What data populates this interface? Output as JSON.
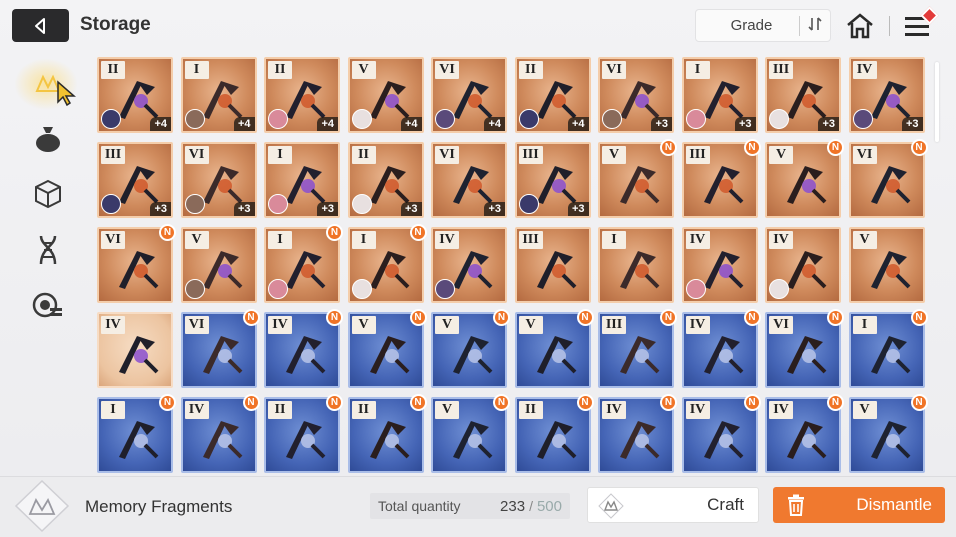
{
  "header": {
    "title": "Storage",
    "sort_label": "Grade",
    "back_icon": "arrow-left-icon",
    "home_icon": "home-icon",
    "menu_icon": "hamburger-menu-icon"
  },
  "sidebar": {
    "items": [
      {
        "icon": "memory-fragment-icon",
        "active": true
      },
      {
        "icon": "bag-icon",
        "active": false
      },
      {
        "icon": "cube-icon",
        "active": false
      },
      {
        "icon": "dna-icon",
        "active": false
      },
      {
        "icon": "chip-list-icon",
        "active": false
      }
    ]
  },
  "colors": {
    "orange_card": "#cf8a5c",
    "blue_card": "#4565b6",
    "peach_card": "#ecc4a0",
    "new_badge": "#f07427",
    "dismantle": "#f0792f"
  },
  "items": [
    {
      "grade": "II",
      "type": "orange",
      "level": "+4",
      "new": false,
      "avatar": true
    },
    {
      "grade": "I",
      "type": "orange",
      "level": "+4",
      "new": false,
      "avatar": true
    },
    {
      "grade": "II",
      "type": "orange",
      "level": "+4",
      "new": false,
      "avatar": true
    },
    {
      "grade": "V",
      "type": "orange",
      "level": "+4",
      "new": false,
      "avatar": true
    },
    {
      "grade": "VI",
      "type": "orange",
      "level": "+4",
      "new": false,
      "avatar": true
    },
    {
      "grade": "II",
      "type": "orange",
      "level": "+4",
      "new": false,
      "avatar": true
    },
    {
      "grade": "VI",
      "type": "orange",
      "level": "+3",
      "new": false,
      "avatar": true
    },
    {
      "grade": "I",
      "type": "orange",
      "level": "+3",
      "new": false,
      "avatar": true
    },
    {
      "grade": "III",
      "type": "orange",
      "level": "+3",
      "new": false,
      "avatar": true
    },
    {
      "grade": "IV",
      "type": "orange",
      "level": "+3",
      "new": false,
      "avatar": true
    },
    {
      "grade": "III",
      "type": "orange",
      "level": "+3",
      "new": false,
      "avatar": true
    },
    {
      "grade": "VI",
      "type": "orange",
      "level": "+3",
      "new": false,
      "avatar": true
    },
    {
      "grade": "I",
      "type": "orange",
      "level": "+3",
      "new": false,
      "avatar": true
    },
    {
      "grade": "II",
      "type": "orange",
      "level": "+3",
      "new": false,
      "avatar": true
    },
    {
      "grade": "VI",
      "type": "orange",
      "level": "+3",
      "new": false,
      "avatar": false
    },
    {
      "grade": "III",
      "type": "orange",
      "level": "+3",
      "new": false,
      "avatar": true
    },
    {
      "grade": "V",
      "type": "orange",
      "level": "",
      "new": true,
      "avatar": false
    },
    {
      "grade": "III",
      "type": "orange",
      "level": "",
      "new": true,
      "avatar": false
    },
    {
      "grade": "V",
      "type": "orange",
      "level": "",
      "new": true,
      "avatar": false
    },
    {
      "grade": "VI",
      "type": "orange",
      "level": "",
      "new": true,
      "avatar": false
    },
    {
      "grade": "VI",
      "type": "orange",
      "level": "",
      "new": true,
      "avatar": false
    },
    {
      "grade": "V",
      "type": "orange",
      "level": "",
      "new": false,
      "avatar": true
    },
    {
      "grade": "I",
      "type": "orange",
      "level": "",
      "new": true,
      "avatar": true
    },
    {
      "grade": "I",
      "type": "orange",
      "level": "",
      "new": true,
      "avatar": true
    },
    {
      "grade": "IV",
      "type": "orange",
      "level": "",
      "new": false,
      "avatar": true
    },
    {
      "grade": "III",
      "type": "orange",
      "level": "",
      "new": false,
      "avatar": false
    },
    {
      "grade": "I",
      "type": "orange",
      "level": "",
      "new": false,
      "avatar": false
    },
    {
      "grade": "IV",
      "type": "orange",
      "level": "",
      "new": false,
      "avatar": true
    },
    {
      "grade": "IV",
      "type": "orange",
      "level": "",
      "new": false,
      "avatar": true
    },
    {
      "grade": "V",
      "type": "orange",
      "level": "",
      "new": false,
      "avatar": false
    },
    {
      "grade": "IV",
      "type": "peach",
      "level": "",
      "new": false,
      "avatar": false
    },
    {
      "grade": "VI",
      "type": "blue",
      "level": "",
      "new": true,
      "avatar": false
    },
    {
      "grade": "IV",
      "type": "blue",
      "level": "",
      "new": true,
      "avatar": false
    },
    {
      "grade": "V",
      "type": "blue",
      "level": "",
      "new": true,
      "avatar": false
    },
    {
      "grade": "V",
      "type": "blue",
      "level": "",
      "new": true,
      "avatar": false
    },
    {
      "grade": "V",
      "type": "blue",
      "level": "",
      "new": true,
      "avatar": false
    },
    {
      "grade": "III",
      "type": "blue",
      "level": "",
      "new": true,
      "avatar": false
    },
    {
      "grade": "IV",
      "type": "blue",
      "level": "",
      "new": true,
      "avatar": false
    },
    {
      "grade": "VI",
      "type": "blue",
      "level": "",
      "new": true,
      "avatar": false
    },
    {
      "grade": "I",
      "type": "blue",
      "level": "",
      "new": true,
      "avatar": false
    },
    {
      "grade": "I",
      "type": "blue",
      "level": "",
      "new": true,
      "avatar": false
    },
    {
      "grade": "IV",
      "type": "blue",
      "level": "",
      "new": true,
      "avatar": false
    },
    {
      "grade": "II",
      "type": "blue",
      "level": "",
      "new": true,
      "avatar": false
    },
    {
      "grade": "II",
      "type": "blue",
      "level": "",
      "new": true,
      "avatar": false
    },
    {
      "grade": "V",
      "type": "blue",
      "level": "",
      "new": true,
      "avatar": false
    },
    {
      "grade": "II",
      "type": "blue",
      "level": "",
      "new": true,
      "avatar": false
    },
    {
      "grade": "IV",
      "type": "blue",
      "level": "",
      "new": true,
      "avatar": false
    },
    {
      "grade": "IV",
      "type": "blue",
      "level": "",
      "new": true,
      "avatar": false
    },
    {
      "grade": "IV",
      "type": "blue",
      "level": "",
      "new": true,
      "avatar": false
    },
    {
      "grade": "V",
      "type": "blue",
      "level": "",
      "new": true,
      "avatar": false
    }
  ],
  "footer": {
    "category_label": "Memory Fragments",
    "total_label": "Total quantity",
    "current": "233",
    "slash": "/",
    "max": "500",
    "craft_label": "Craft",
    "dismantle_label": "Dismantle",
    "new_badge": "N"
  }
}
